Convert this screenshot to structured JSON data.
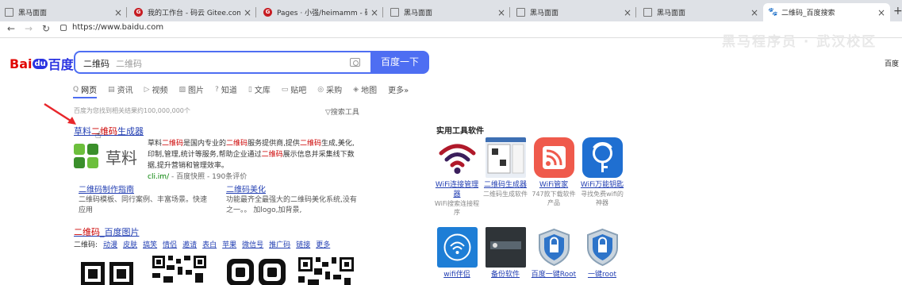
{
  "tabs": [
    {
      "title": "黑马面面",
      "icon": "page-icon"
    },
    {
      "title": "我的工作台 - 码云 Gitee.com",
      "icon": "gitee-icon"
    },
    {
      "title": "Pages · 小强/heimamm - 码云",
      "icon": "gitee-icon"
    },
    {
      "title": "黑马面面",
      "icon": "page-icon"
    },
    {
      "title": "黑马面面",
      "icon": "page-icon"
    },
    {
      "title": "黑马面面",
      "icon": "page-icon"
    },
    {
      "title": "二维码_百度搜索",
      "icon": "baidu-paw-icon"
    }
  ],
  "close_glyph": "×",
  "new_tab_glyph": "+",
  "address": {
    "url": "https://www.baidu.com"
  },
  "baidu": {
    "logo_bai": "Bai",
    "logo_du": "du",
    "logo_cn": "百度",
    "query": "二维码",
    "hint": "二维码",
    "search_button": "百度一下",
    "top_right": "百度",
    "background_text": "黑马程序员 · 武汉校区"
  },
  "search_tabs": [
    {
      "icon": "search-icon",
      "label": "网页"
    },
    {
      "icon": "news-icon",
      "label": "资讯"
    },
    {
      "icon": "video-icon",
      "label": "视频"
    },
    {
      "icon": "image-icon",
      "label": "图片"
    },
    {
      "icon": "zhidao-icon",
      "label": "知道"
    },
    {
      "icon": "doc-icon",
      "label": "文库"
    },
    {
      "icon": "tieba-icon",
      "label": "贴吧"
    },
    {
      "icon": "caigou-icon",
      "label": "采购"
    },
    {
      "icon": "map-icon",
      "label": "地图"
    },
    {
      "icon": "more-icon",
      "label": "更多»"
    }
  ],
  "result_count": "百度为您找到相关结果约100,000,000个",
  "search_tools": "搜索工具",
  "result1": {
    "title_pre": "草料",
    "title_hl": "二维码",
    "title_post": "生成器",
    "logo_text": "草料",
    "desc": [
      {
        "t": "草料",
        "hl": false
      },
      {
        "t": "二维码",
        "hl": true
      },
      {
        "t": "是国内专业的",
        "hl": false
      },
      {
        "t": "二维码",
        "hl": true
      },
      {
        "t": "服务提供商,提供",
        "hl": false
      },
      {
        "t": "二维码",
        "hl": true
      },
      {
        "t": "生成,美化,印制,管理,统计等服务,帮助企业通过",
        "hl": false
      },
      {
        "t": "二维码",
        "hl": true
      },
      {
        "t": "展示信息并采集线下数据,提升营销和管理效率。",
        "hl": false
      }
    ],
    "url": "cli.im/",
    "url_meta": " - 百度快照 - 190条评价",
    "sublinks": [
      {
        "title": "二维码制作指南",
        "desc": "二维码模板、同行案例、丰富场景。快速应用"
      },
      {
        "title": "二维码美化",
        "desc": "功能最齐全最强大的二维码美化系统,没有之一。。 加logo,加背景,"
      }
    ]
  },
  "result2": {
    "title_hl": "二维码",
    "title_post": "_百度图片",
    "links_label": "二维码:",
    "links": [
      "动漫",
      "皮肤",
      "搞笑",
      "情侣",
      "邀请",
      "表白",
      "苹果",
      "微信号",
      "推广码",
      "链接",
      "更多"
    ]
  },
  "sidebar": {
    "heading": "实用工具软件",
    "apps": [
      {
        "name": "WiFi连接管理器",
        "desc": "WiFi搜索连接程序",
        "icon": "wifi-signal-icon"
      },
      {
        "name": "二维码生成器",
        "desc": "二维码生成软件",
        "icon": "qr-generator-icon"
      },
      {
        "name": "WiFi管家",
        "desc": "747款下载软件产品",
        "icon": "wifi-manager-icon"
      },
      {
        "name": "WiFi万能钥匙",
        "desc": "寻找免费wifi的神器",
        "icon": "wifi-key-icon"
      },
      {
        "name": "wifi伴侣",
        "desc": "",
        "icon": "wifi-partner-icon"
      },
      {
        "name": "备份软件",
        "desc": "",
        "icon": "backup-icon"
      },
      {
        "name": "百度一键Root",
        "desc": "",
        "icon": "root-shield-icon"
      },
      {
        "name": "一键root",
        "desc": "",
        "icon": "root-shield-icon"
      }
    ]
  },
  "colors": {
    "accent": "#4e6ef2",
    "link": "#2440b3",
    "highlight": "#c00000",
    "logo_red": "#e10602",
    "logo_blue": "#2932e1"
  }
}
